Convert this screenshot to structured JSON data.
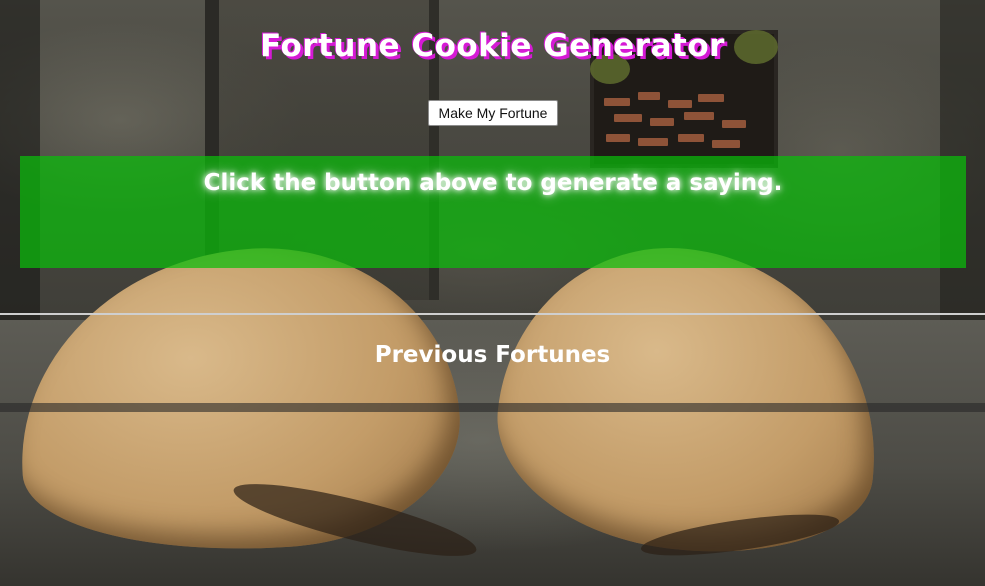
{
  "page": {
    "title": "Fortune Cookie Generator",
    "make_button_label": "Make My Fortune",
    "fortune_text": "Click the button above to generate a saying.",
    "previous_heading": "Previous Fortunes",
    "previous_fortunes": []
  },
  "colors": {
    "title_shadow": "#d51ad5",
    "fortune_box": "#0abe0a",
    "text": "#ffffff"
  },
  "icons": {
    "background": "ruined-room-with-giant-fortune-cookies"
  }
}
